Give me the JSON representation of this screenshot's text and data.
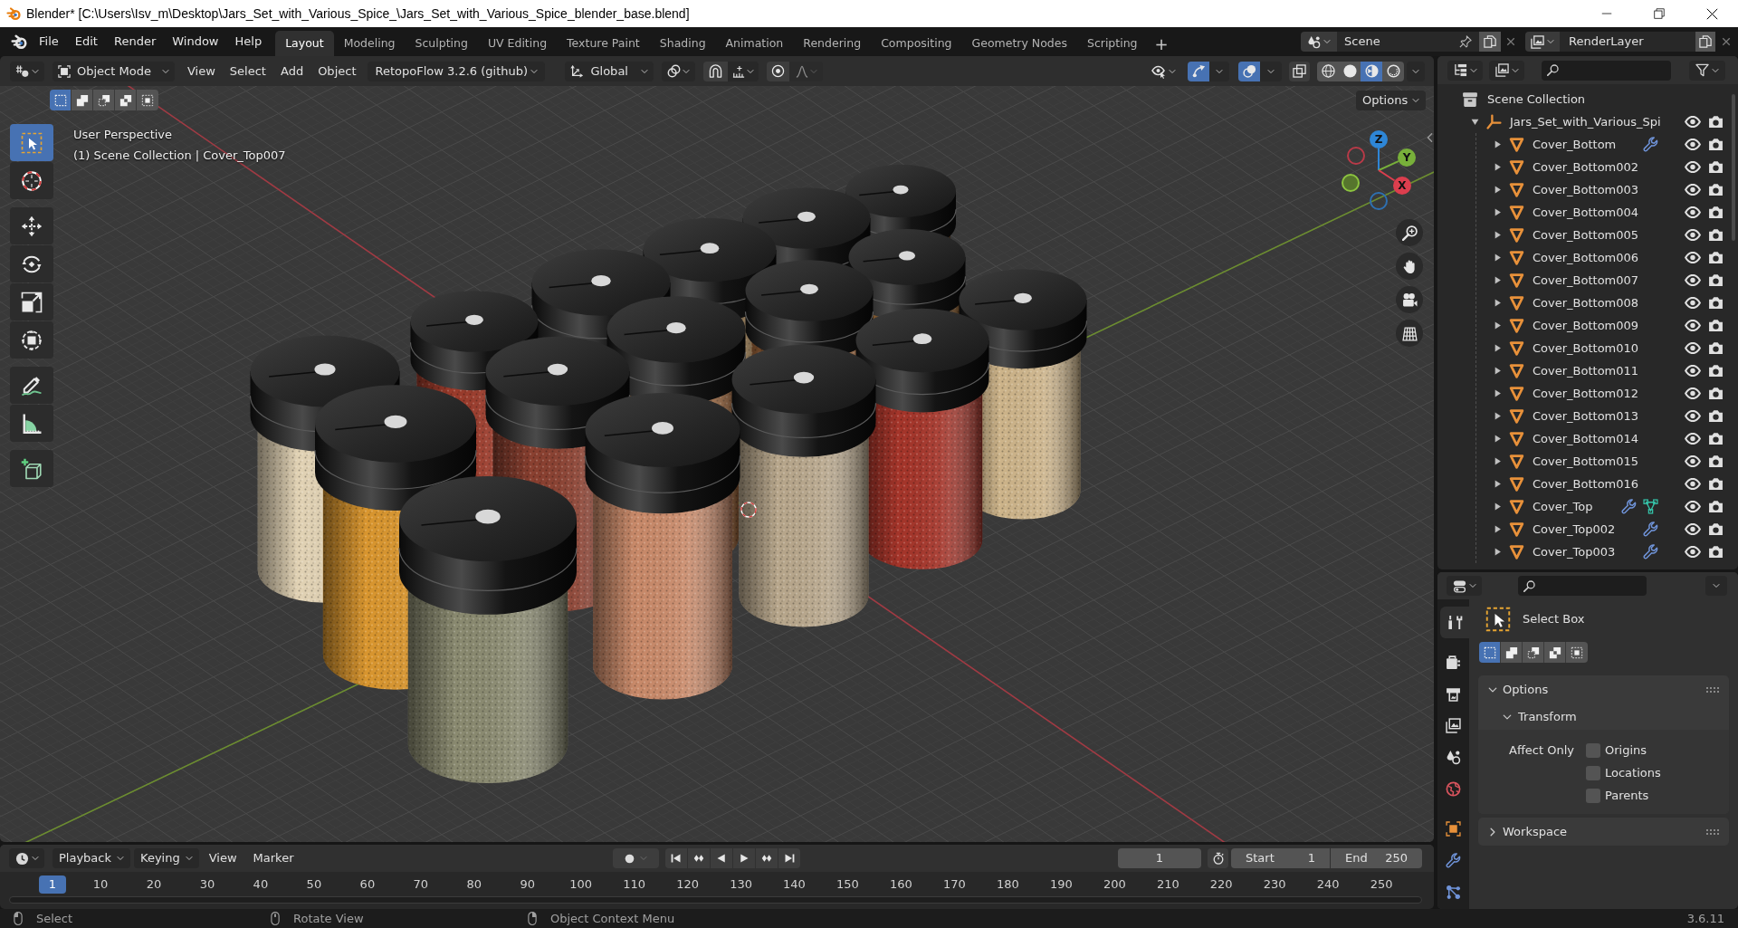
{
  "window": {
    "title": "Blender* [C:\\Users\\Isv_m\\Desktop\\Jars_Set_with_Various_Spice_\\Jars_Set_with_Various_Spice_blender_base.blend]"
  },
  "menu_bar": {
    "menus": [
      "File",
      "Edit",
      "Render",
      "Window",
      "Help"
    ],
    "workspaces": [
      {
        "label": "Layout",
        "selected": true
      },
      {
        "label": "Modeling",
        "selected": false
      },
      {
        "label": "Sculpting",
        "selected": false
      },
      {
        "label": "UV Editing",
        "selected": false
      },
      {
        "label": "Texture Paint",
        "selected": false
      },
      {
        "label": "Shading",
        "selected": false
      },
      {
        "label": "Animation",
        "selected": false
      },
      {
        "label": "Rendering",
        "selected": false
      },
      {
        "label": "Compositing",
        "selected": false
      },
      {
        "label": "Geometry Nodes",
        "selected": false
      },
      {
        "label": "Scripting",
        "selected": false
      }
    ],
    "add_workspace": "+",
    "scene": "Scene",
    "view_layer": "RenderLayer"
  },
  "viewport_header": {
    "mode": "Object Mode",
    "menus": [
      "View",
      "Select",
      "Add",
      "Object"
    ],
    "addon_menu": "RetopoFlow 3.2.6 (github)",
    "orientation": "Global",
    "snapping": false,
    "proportional_editing": false,
    "gizmos": true,
    "overlays": true,
    "xray": false,
    "shading": [
      {
        "kind": "wireframe",
        "selected": false
      },
      {
        "kind": "solid",
        "selected": false
      },
      {
        "kind": "material",
        "selected": true
      },
      {
        "kind": "rendered",
        "selected": false
      }
    ]
  },
  "tool_settings": {
    "select_modes": [
      {
        "kind": "set",
        "selected": true
      },
      {
        "kind": "extend",
        "selected": false
      },
      {
        "kind": "subtract",
        "selected": false
      },
      {
        "kind": "difference",
        "selected": false
      },
      {
        "kind": "intersect",
        "selected": false
      }
    ],
    "options_button": "Options"
  },
  "viewport": {
    "view_name": "User Perspective",
    "info": "(1) Scene Collection | Cover_Top007",
    "tool_groups": [
      {
        "tools": [
          {
            "kind": "select_box",
            "selected": true
          },
          {
            "kind": "cursor",
            "selected": false
          }
        ]
      },
      {
        "tools": [
          {
            "kind": "move",
            "selected": false
          },
          {
            "kind": "rotate",
            "selected": false
          },
          {
            "kind": "scale",
            "selected": false
          },
          {
            "kind": "transform",
            "selected": false
          }
        ]
      },
      {
        "tools": [
          {
            "kind": "annotate",
            "selected": false
          },
          {
            "kind": "measure",
            "selected": false
          }
        ]
      },
      {
        "tools": [
          {
            "kind": "add_cube",
            "selected": false
          }
        ]
      }
    ],
    "gizmo_axes": [
      "Z",
      "Y",
      "X"
    ]
  },
  "outliner": {
    "tree": [
      {
        "label": "Scene Collection",
        "kind": "scene_collection",
        "children": [
          {
            "label": "Jars_Set_with_Various_Spi",
            "kind": "empty",
            "expanded": true,
            "visible": true,
            "renderable": true,
            "children": [
              {
                "label": "Cover_Bottom",
                "kind": "mesh",
                "expanded": false,
                "modifier": true,
                "vertex_groups": false,
                "visible": true,
                "renderable": true
              },
              {
                "label": "Cover_Bottom002",
                "kind": "mesh",
                "expanded": false,
                "modifier": false,
                "vertex_groups": false,
                "visible": true,
                "renderable": true
              },
              {
                "label": "Cover_Bottom003",
                "kind": "mesh",
                "expanded": false,
                "modifier": false,
                "vertex_groups": false,
                "visible": true,
                "renderable": true
              },
              {
                "label": "Cover_Bottom004",
                "kind": "mesh",
                "expanded": false,
                "modifier": false,
                "vertex_groups": false,
                "visible": true,
                "renderable": true
              },
              {
                "label": "Cover_Bottom005",
                "kind": "mesh",
                "expanded": false,
                "modifier": false,
                "vertex_groups": false,
                "visible": true,
                "renderable": true
              },
              {
                "label": "Cover_Bottom006",
                "kind": "mesh",
                "expanded": false,
                "modifier": false,
                "vertex_groups": false,
                "visible": true,
                "renderable": true
              },
              {
                "label": "Cover_Bottom007",
                "kind": "mesh",
                "expanded": false,
                "modifier": false,
                "vertex_groups": false,
                "visible": true,
                "renderable": true
              },
              {
                "label": "Cover_Bottom008",
                "kind": "mesh",
                "expanded": false,
                "modifier": false,
                "vertex_groups": false,
                "visible": true,
                "renderable": true
              },
              {
                "label": "Cover_Bottom009",
                "kind": "mesh",
                "expanded": false,
                "modifier": false,
                "vertex_groups": false,
                "visible": true,
                "renderable": true
              },
              {
                "label": "Cover_Bottom010",
                "kind": "mesh",
                "expanded": false,
                "modifier": false,
                "vertex_groups": false,
                "visible": true,
                "renderable": true
              },
              {
                "label": "Cover_Bottom011",
                "kind": "mesh",
                "expanded": false,
                "modifier": false,
                "vertex_groups": false,
                "visible": true,
                "renderable": true
              },
              {
                "label": "Cover_Bottom012",
                "kind": "mesh",
                "expanded": false,
                "modifier": false,
                "vertex_groups": false,
                "visible": true,
                "renderable": true
              },
              {
                "label": "Cover_Bottom013",
                "kind": "mesh",
                "expanded": false,
                "modifier": false,
                "vertex_groups": false,
                "visible": true,
                "renderable": true
              },
              {
                "label": "Cover_Bottom014",
                "kind": "mesh",
                "expanded": false,
                "modifier": false,
                "vertex_groups": false,
                "visible": true,
                "renderable": true
              },
              {
                "label": "Cover_Bottom015",
                "kind": "mesh",
                "expanded": false,
                "modifier": false,
                "vertex_groups": false,
                "visible": true,
                "renderable": true
              },
              {
                "label": "Cover_Bottom016",
                "kind": "mesh",
                "expanded": false,
                "modifier": false,
                "vertex_groups": false,
                "visible": true,
                "renderable": true
              },
              {
                "label": "Cover_Top",
                "kind": "mesh",
                "expanded": false,
                "modifier": true,
                "vertex_groups": true,
                "visible": true,
                "renderable": true
              },
              {
                "label": "Cover_Top002",
                "kind": "mesh",
                "expanded": false,
                "modifier": true,
                "vertex_groups": false,
                "visible": true,
                "renderable": true
              },
              {
                "label": "Cover_Top003",
                "kind": "mesh",
                "expanded": false,
                "modifier": true,
                "vertex_groups": false,
                "visible": true,
                "renderable": true
              }
            ]
          }
        ]
      }
    ]
  },
  "properties": {
    "tab_groups": [
      {
        "tabs": [
          {
            "kind": "tool",
            "selected": true
          }
        ]
      },
      {
        "tabs": [
          {
            "kind": "render",
            "selected": false
          },
          {
            "kind": "output",
            "selected": false
          },
          {
            "kind": "view_layer",
            "selected": false
          },
          {
            "kind": "scene",
            "selected": false
          },
          {
            "kind": "world",
            "selected": false
          }
        ]
      },
      {
        "tabs": [
          {
            "kind": "object",
            "selected": false
          },
          {
            "kind": "modifiers",
            "selected": false
          },
          {
            "kind": "particles",
            "selected": false
          }
        ]
      }
    ],
    "tool_name": "Select Box",
    "select_modes": [
      {
        "kind": "set",
        "selected": true
      },
      {
        "kind": "extend",
        "selected": false
      },
      {
        "kind": "subtract",
        "selected": false
      },
      {
        "kind": "difference",
        "selected": false
      },
      {
        "kind": "intersect",
        "selected": false
      }
    ],
    "panels": [
      {
        "title": "Options",
        "expanded": true,
        "subpanels": [
          {
            "title": "Transform",
            "expanded": true,
            "field_label": "Affect Only",
            "options": [
              {
                "label": "Origins",
                "checked": false
              },
              {
                "label": "Locations",
                "checked": false
              },
              {
                "label": "Parents",
                "checked": false
              }
            ]
          }
        ]
      },
      {
        "title": "Workspace",
        "expanded": false
      }
    ]
  },
  "timeline": {
    "menus": [
      {
        "label": "Playback",
        "dropdown": true
      },
      {
        "label": "Keying",
        "dropdown": true
      },
      {
        "label": "View",
        "dropdown": false
      },
      {
        "label": "Marker",
        "dropdown": false
      }
    ],
    "auto_keying": false,
    "current_frame": "1",
    "start_label": "Start",
    "start": "1",
    "end_label": "End",
    "end": "250",
    "ruler": [
      {
        "label": "1",
        "selected": true
      },
      {
        "label": "10",
        "selected": false
      },
      {
        "label": "20",
        "selected": false
      },
      {
        "label": "30",
        "selected": false
      },
      {
        "label": "40",
        "selected": false
      },
      {
        "label": "50",
        "selected": false
      },
      {
        "label": "60",
        "selected": false
      },
      {
        "label": "70",
        "selected": false
      },
      {
        "label": "80",
        "selected": false
      },
      {
        "label": "90",
        "selected": false
      },
      {
        "label": "100",
        "selected": false
      },
      {
        "label": "110",
        "selected": false
      },
      {
        "label": "120",
        "selected": false
      },
      {
        "label": "130",
        "selected": false
      },
      {
        "label": "140",
        "selected": false
      },
      {
        "label": "150",
        "selected": false
      },
      {
        "label": "160",
        "selected": false
      },
      {
        "label": "170",
        "selected": false
      },
      {
        "label": "180",
        "selected": false
      },
      {
        "label": "190",
        "selected": false
      },
      {
        "label": "200",
        "selected": false
      },
      {
        "label": "210",
        "selected": false
      },
      {
        "label": "220",
        "selected": false
      },
      {
        "label": "230",
        "selected": false
      },
      {
        "label": "240",
        "selected": false
      },
      {
        "label": "250",
        "selected": false
      }
    ]
  },
  "status_bar": {
    "hints": [
      {
        "kind": "left",
        "label": "Select"
      },
      {
        "kind": "middle",
        "label": "Rotate View"
      },
      {
        "kind": "right",
        "label": "Object Context Menu"
      }
    ],
    "version": "3.6.11"
  }
}
